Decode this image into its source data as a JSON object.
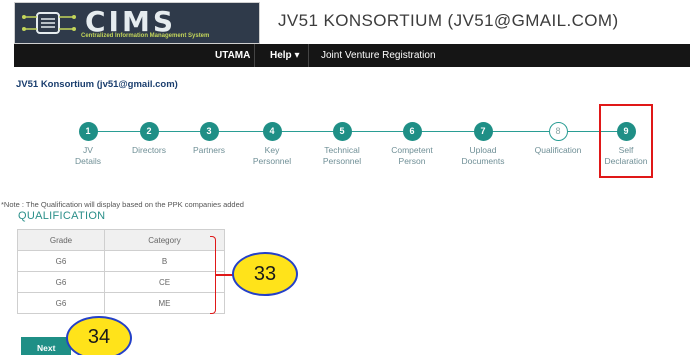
{
  "header": {
    "logo_word": "CIMS",
    "logo_sub": "Centralized Information Management System",
    "title": "JV51 KONSORTIUM (JV51@GMAIL.COM)"
  },
  "navbar": {
    "items": [
      {
        "label": "UTAMA"
      },
      {
        "label": "Help ▾"
      },
      {
        "label": "Joint Venture Registration"
      }
    ]
  },
  "user_label": "JV51 Konsortium (jv51@gmail.com)",
  "steps": [
    {
      "number": "1",
      "label": "JV\nDetails",
      "state": "done"
    },
    {
      "number": "2",
      "label": "Directors",
      "state": "done"
    },
    {
      "number": "3",
      "label": "Partners",
      "state": "done"
    },
    {
      "number": "4",
      "label": "Key\nPersonnel",
      "state": "done"
    },
    {
      "number": "5",
      "label": "Technical\nPersonnel",
      "state": "done"
    },
    {
      "number": "6",
      "label": "Competent\nPerson",
      "state": "done"
    },
    {
      "number": "7",
      "label": "Upload\nDocuments",
      "state": "done"
    },
    {
      "number": "8",
      "label": "Qualification",
      "state": "current"
    },
    {
      "number": "9",
      "label": "Self\nDeclaration",
      "state": "done"
    }
  ],
  "note": "*Note : The Qualification will display based on the PPK companies added",
  "qualification": {
    "title": "QUALIFICATION",
    "headers": [
      "Grade",
      "Category"
    ],
    "rows": [
      [
        "G6",
        "B"
      ],
      [
        "G6",
        "CE"
      ],
      [
        "G6",
        "ME"
      ]
    ]
  },
  "annotations": {
    "callout_table": "33",
    "callout_next": "34"
  },
  "buttons": {
    "next_label": "Next"
  },
  "colors": {
    "accent": "#1f8f86",
    "nav_bg": "#151515",
    "highlight": "#e01818",
    "callout_fill": "#ffe31a",
    "callout_border": "#2440c8"
  }
}
